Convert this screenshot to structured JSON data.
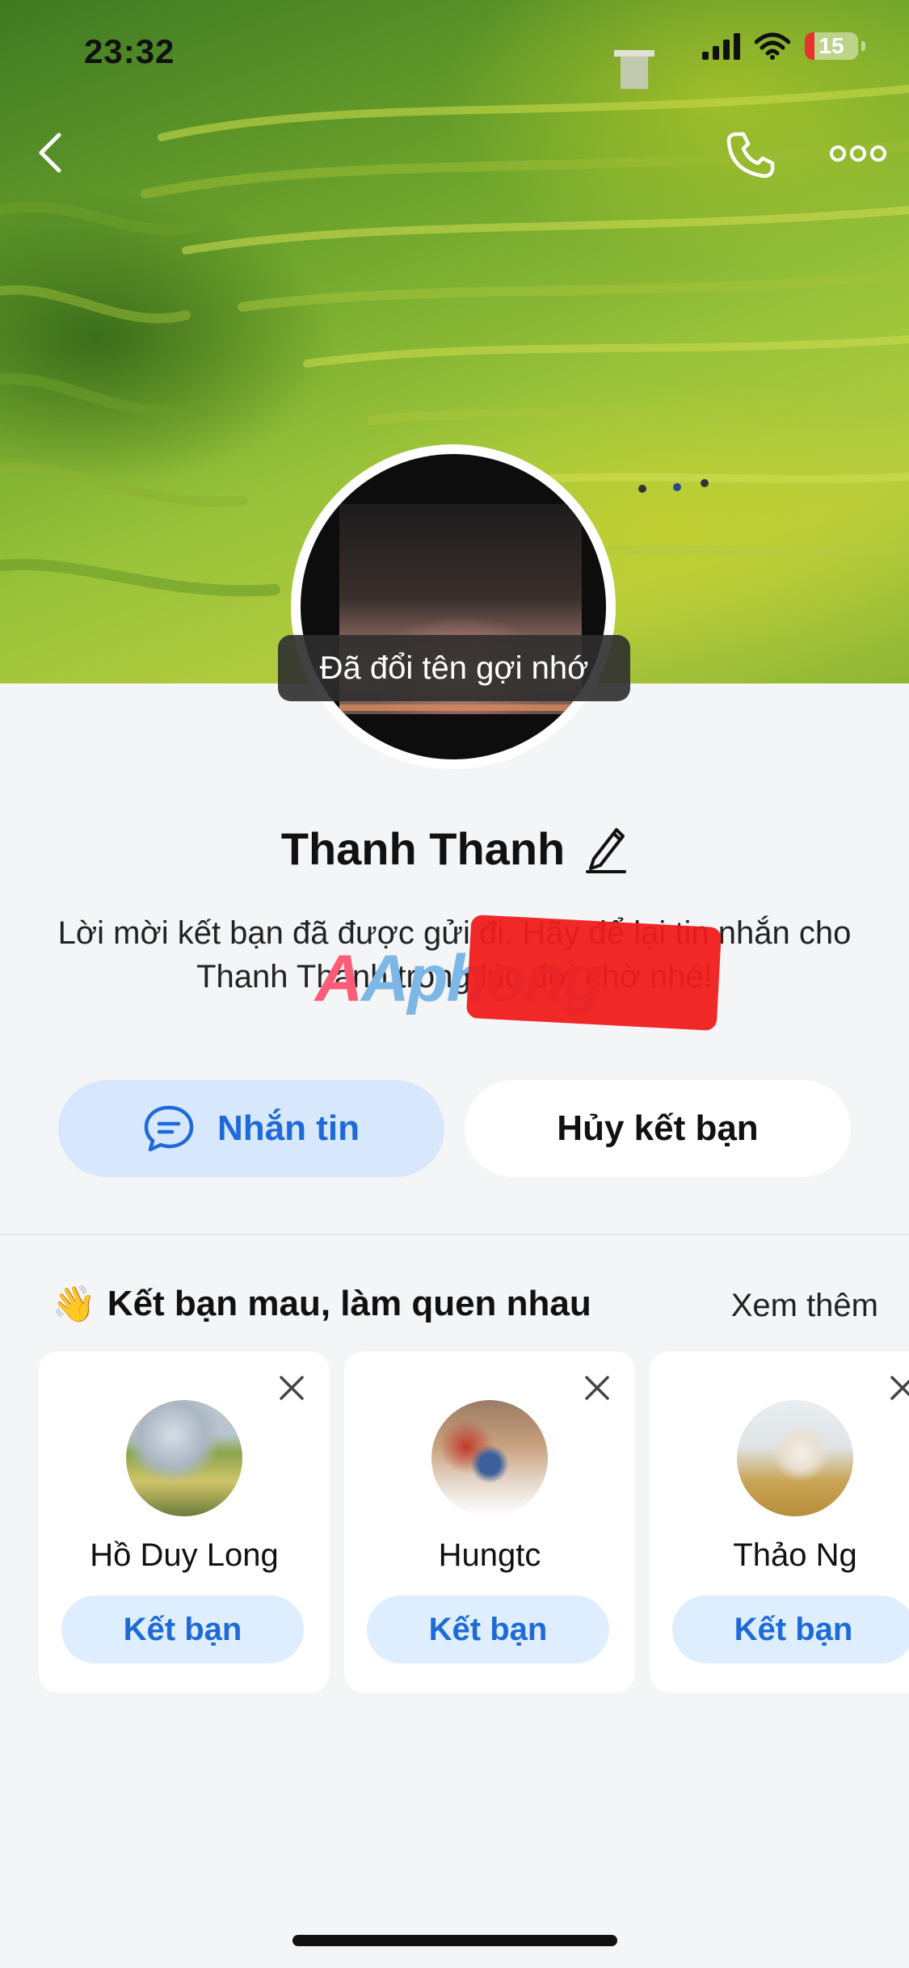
{
  "status_bar": {
    "time": "23:32",
    "battery": "15"
  },
  "profile": {
    "toast": "Đã đổi tên gợi nhớ",
    "name": "Thanh Thanh",
    "description": "Lời mời kết bạn đã được gửi đi. Hãy để lại tin nhắn cho Thanh Thanh trong lúc đợi chờ nhé!",
    "watermark": "Aphong",
    "actions": {
      "message_label": "Nhắn tin",
      "unfriend_label": "Hủy kết bạn"
    }
  },
  "suggestions": {
    "title": "Kết bạn mau, làm quen nhau",
    "title_emoji": "👋",
    "see_more": "Xem thêm",
    "people": [
      {
        "name": "Hồ Duy Long",
        "action": "Kết bạn"
      },
      {
        "name": "Hungtc",
        "action": "Kết bạn"
      },
      {
        "name": "Thảo Ng",
        "action": "Kết bạn"
      }
    ]
  },
  "colors": {
    "accent": "#1e6ad8",
    "accent_bg": "#d7e8fd",
    "background": "#f4f5f7"
  },
  "icons": [
    "back-icon",
    "phone-icon",
    "more-icon",
    "edit-icon",
    "chat-icon",
    "close-icon"
  ]
}
